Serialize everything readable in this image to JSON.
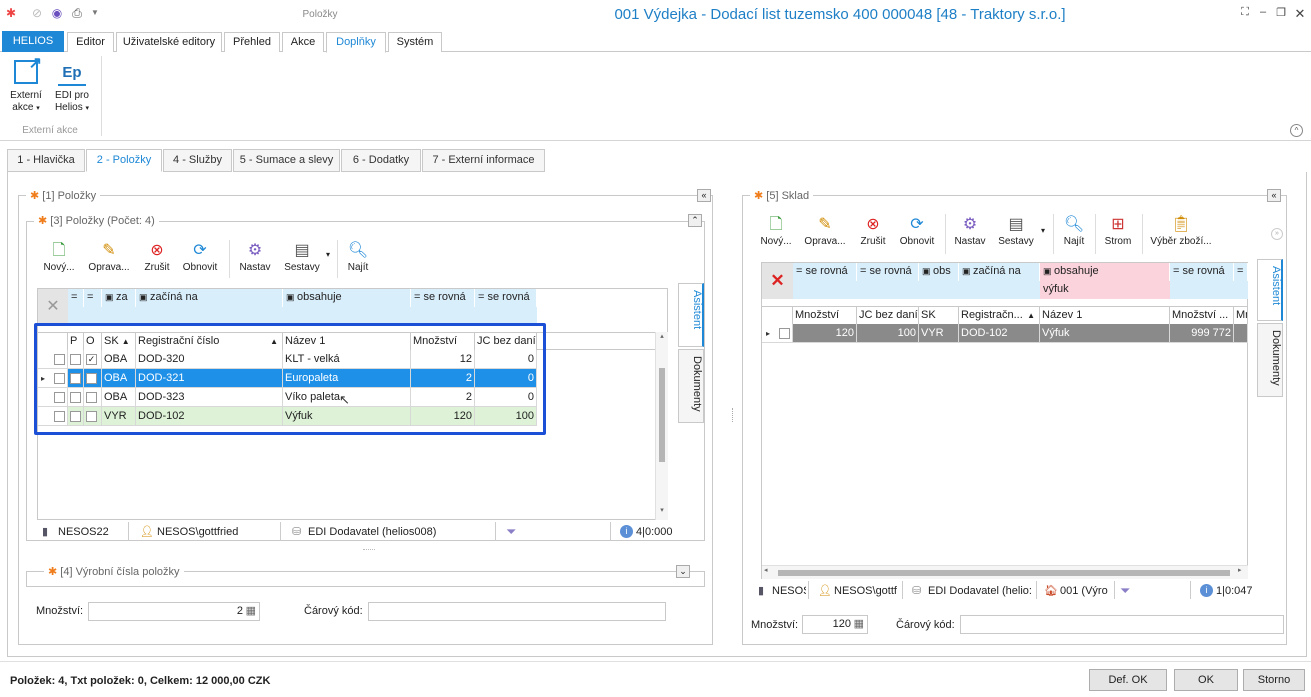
{
  "window": {
    "qa_title": "Položky",
    "doc_title": "001  Výdejka - Dodací list tuzemsko  400 000048 [48 - Traktory s.r.o.]"
  },
  "ribbon_tabs": [
    "HELIOS",
    "Editor",
    "Uživatelské editory",
    "Přehled",
    "Akce",
    "Doplňky",
    "Systém"
  ],
  "ribbon": {
    "btn1": {
      "line1": "Externí",
      "line2": "akce"
    },
    "btn2": {
      "icon_text": "Ep",
      "line1": "EDI pro",
      "line2": "Helios"
    },
    "group_label": "Externí akce"
  },
  "doc_tabs": [
    "1 - Hlavička",
    "2 - Položky",
    "4 - Služby",
    "5 - Sumace a slevy",
    "6 - Dodatky",
    "7 - Externí informace"
  ],
  "left": {
    "group_title": "[1] Položky",
    "sub_title": "[3] Položky (Počet: 4)",
    "toolbar": [
      "Nový...",
      "Oprava...",
      "Zrušit",
      "Obnovit",
      "Nastav",
      "Sestavy",
      "Najít"
    ],
    "filter": [
      "=",
      "=",
      "za",
      "začíná na",
      "obsahuje",
      "se rovná",
      "se rovná"
    ],
    "columns": [
      "P",
      "O",
      "SK",
      "Registrační číslo",
      "Název 1",
      "Množství",
      "JC bez daní"
    ],
    "rows": [
      {
        "sk": "OBA",
        "reg": "DOD-320",
        "name": "KLT - velká",
        "qty": "12",
        "jc": "0"
      },
      {
        "sk": "OBA",
        "reg": "DOD-321",
        "name": "Europaleta",
        "qty": "2",
        "jc": "0"
      },
      {
        "sk": "OBA",
        "reg": "DOD-323",
        "name": "Víko paleta",
        "qty": "2",
        "jc": "0"
      },
      {
        "sk": "VYR",
        "reg": "DOD-102",
        "name": "Výfuk",
        "qty": "120",
        "jc": "100"
      }
    ],
    "status": [
      "NESOS22",
      "NESOS\\gottfried",
      "EDI Dodavatel (helios008)",
      "4|0:000"
    ],
    "sub2_title": "[4] Výrobní čísla položky",
    "qty_label": "Množství:",
    "qty_value": "2",
    "barcode_label": "Čárový kód:",
    "side_tabs": [
      "Asistent",
      "Dokumenty"
    ]
  },
  "right": {
    "group_title": "[5] Sklad",
    "toolbar": [
      "Nový...",
      "Oprava...",
      "Zrušit",
      "Obnovit",
      "Nastav",
      "Sestavy",
      "Najít",
      "Strom",
      "Výběr zboží..."
    ],
    "filter": [
      "se rovná",
      "se rovná",
      "obs",
      "začíná na",
      "obsahuje",
      "se rovná"
    ],
    "filter_value": "výfuk",
    "columns": [
      "Množství",
      "JC bez daní",
      "SK",
      "Registračn...",
      "Název 1",
      "Množství ...",
      "Mr"
    ],
    "row": {
      "qty": "120",
      "jc": "100",
      "sk": "VYR",
      "reg": "DOD-102",
      "name": "Výfuk",
      "qty2": "999 772"
    },
    "status": [
      "NESOS",
      "NESOS\\gottf",
      "EDI Dodavatel (helio:",
      "001 (Výro",
      "1|0:047"
    ],
    "qty_label": "Množství:",
    "qty_value": "120",
    "barcode_label": "Čárový kód:",
    "side_tabs": [
      "Asistent",
      "Dokumenty"
    ]
  },
  "footer": {
    "summary": "Položek: 4,  Txt položek: 0,  Celkem: 12 000,00 CZK",
    "def_ok": "Def. OK",
    "ok": "OK",
    "storno": "Storno"
  },
  "colors": {
    "accent": "#1e88d6",
    "selection": "#1e90e8",
    "highlight_frame": "#1a4fd6",
    "green_row": "#ddf2d7",
    "pink_filter": "#fbd3dc"
  }
}
